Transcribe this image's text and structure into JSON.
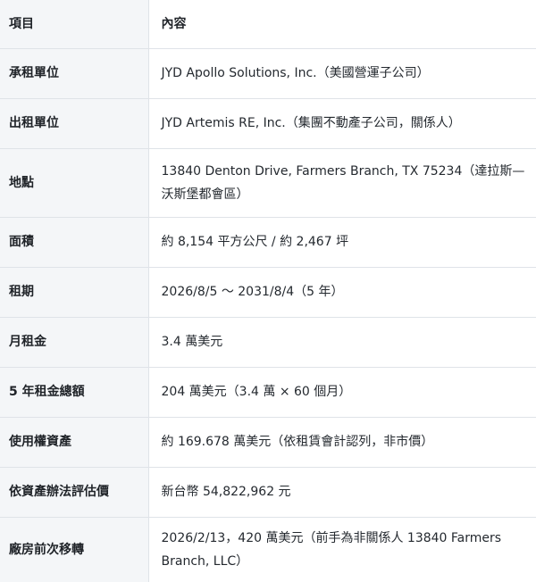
{
  "table": {
    "headers": {
      "item": "項目",
      "content": "內容"
    },
    "rows": [
      {
        "label": "承租單位",
        "value": "JYD Apollo Solutions, Inc.（美國營運子公司）"
      },
      {
        "label": "出租單位",
        "value": "JYD Artemis RE, Inc.（集團不動產子公司，關係人）"
      },
      {
        "label": "地點",
        "value": "13840 Denton Drive, Farmers Branch, TX 75234（達拉斯—沃斯堡都會區）"
      },
      {
        "label": "面積",
        "value": "約 8,154 平方公尺 / 約 2,467 坪"
      },
      {
        "label": "租期",
        "value": "2026/8/5 ～ 2031/8/4（5 年）"
      },
      {
        "label": "月租金",
        "value": "3.4 萬美元"
      },
      {
        "label": "5 年租金總額",
        "value": "204 萬美元（3.4 萬 × 60 個月）"
      },
      {
        "label": "使用權資產",
        "value": "約 169.678 萬美元（依租賃會計認列，非市價）"
      },
      {
        "label": "依資產辦法評估價",
        "value": "新台幣 54,822,962 元"
      },
      {
        "label": "廠房前次移轉",
        "value": "2026/2/13，420 萬美元（前手為非關係人 13840 Farmers Branch, LLC）"
      }
    ]
  }
}
